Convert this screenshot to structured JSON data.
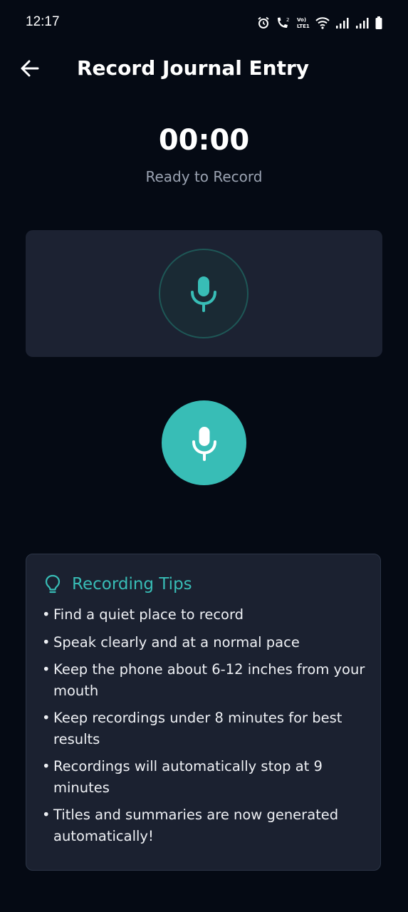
{
  "status_bar": {
    "time": "12:17",
    "icons": [
      "alarm-icon",
      "wifi-call-icon",
      "volte-icon",
      "wifi-icon",
      "signal-icon",
      "signal-icon",
      "battery-icon"
    ]
  },
  "header": {
    "title": "Record Journal Entry",
    "back_icon": "arrow-left-icon"
  },
  "recorder": {
    "timer": "00:00",
    "status": "Ready to Record",
    "visualizer_icon": "microphone-icon",
    "record_button_icon": "microphone-icon"
  },
  "tips": {
    "title": "Recording Tips",
    "icon": "lightbulb-icon",
    "bullet": "•",
    "items": [
      "Find a quiet place to record",
      "Speak clearly and at a normal pace",
      "Keep the phone about 6-12 inches from your mouth",
      "Keep recordings under 8 minutes for best results",
      "Recordings will automatically stop at 9 minutes",
      "Titles and summaries are now generated automatically!"
    ]
  },
  "colors": {
    "background": "#050a14",
    "accent": "#38bdb6",
    "panel": "#1c2232",
    "muted_text": "#9aa2b1"
  }
}
